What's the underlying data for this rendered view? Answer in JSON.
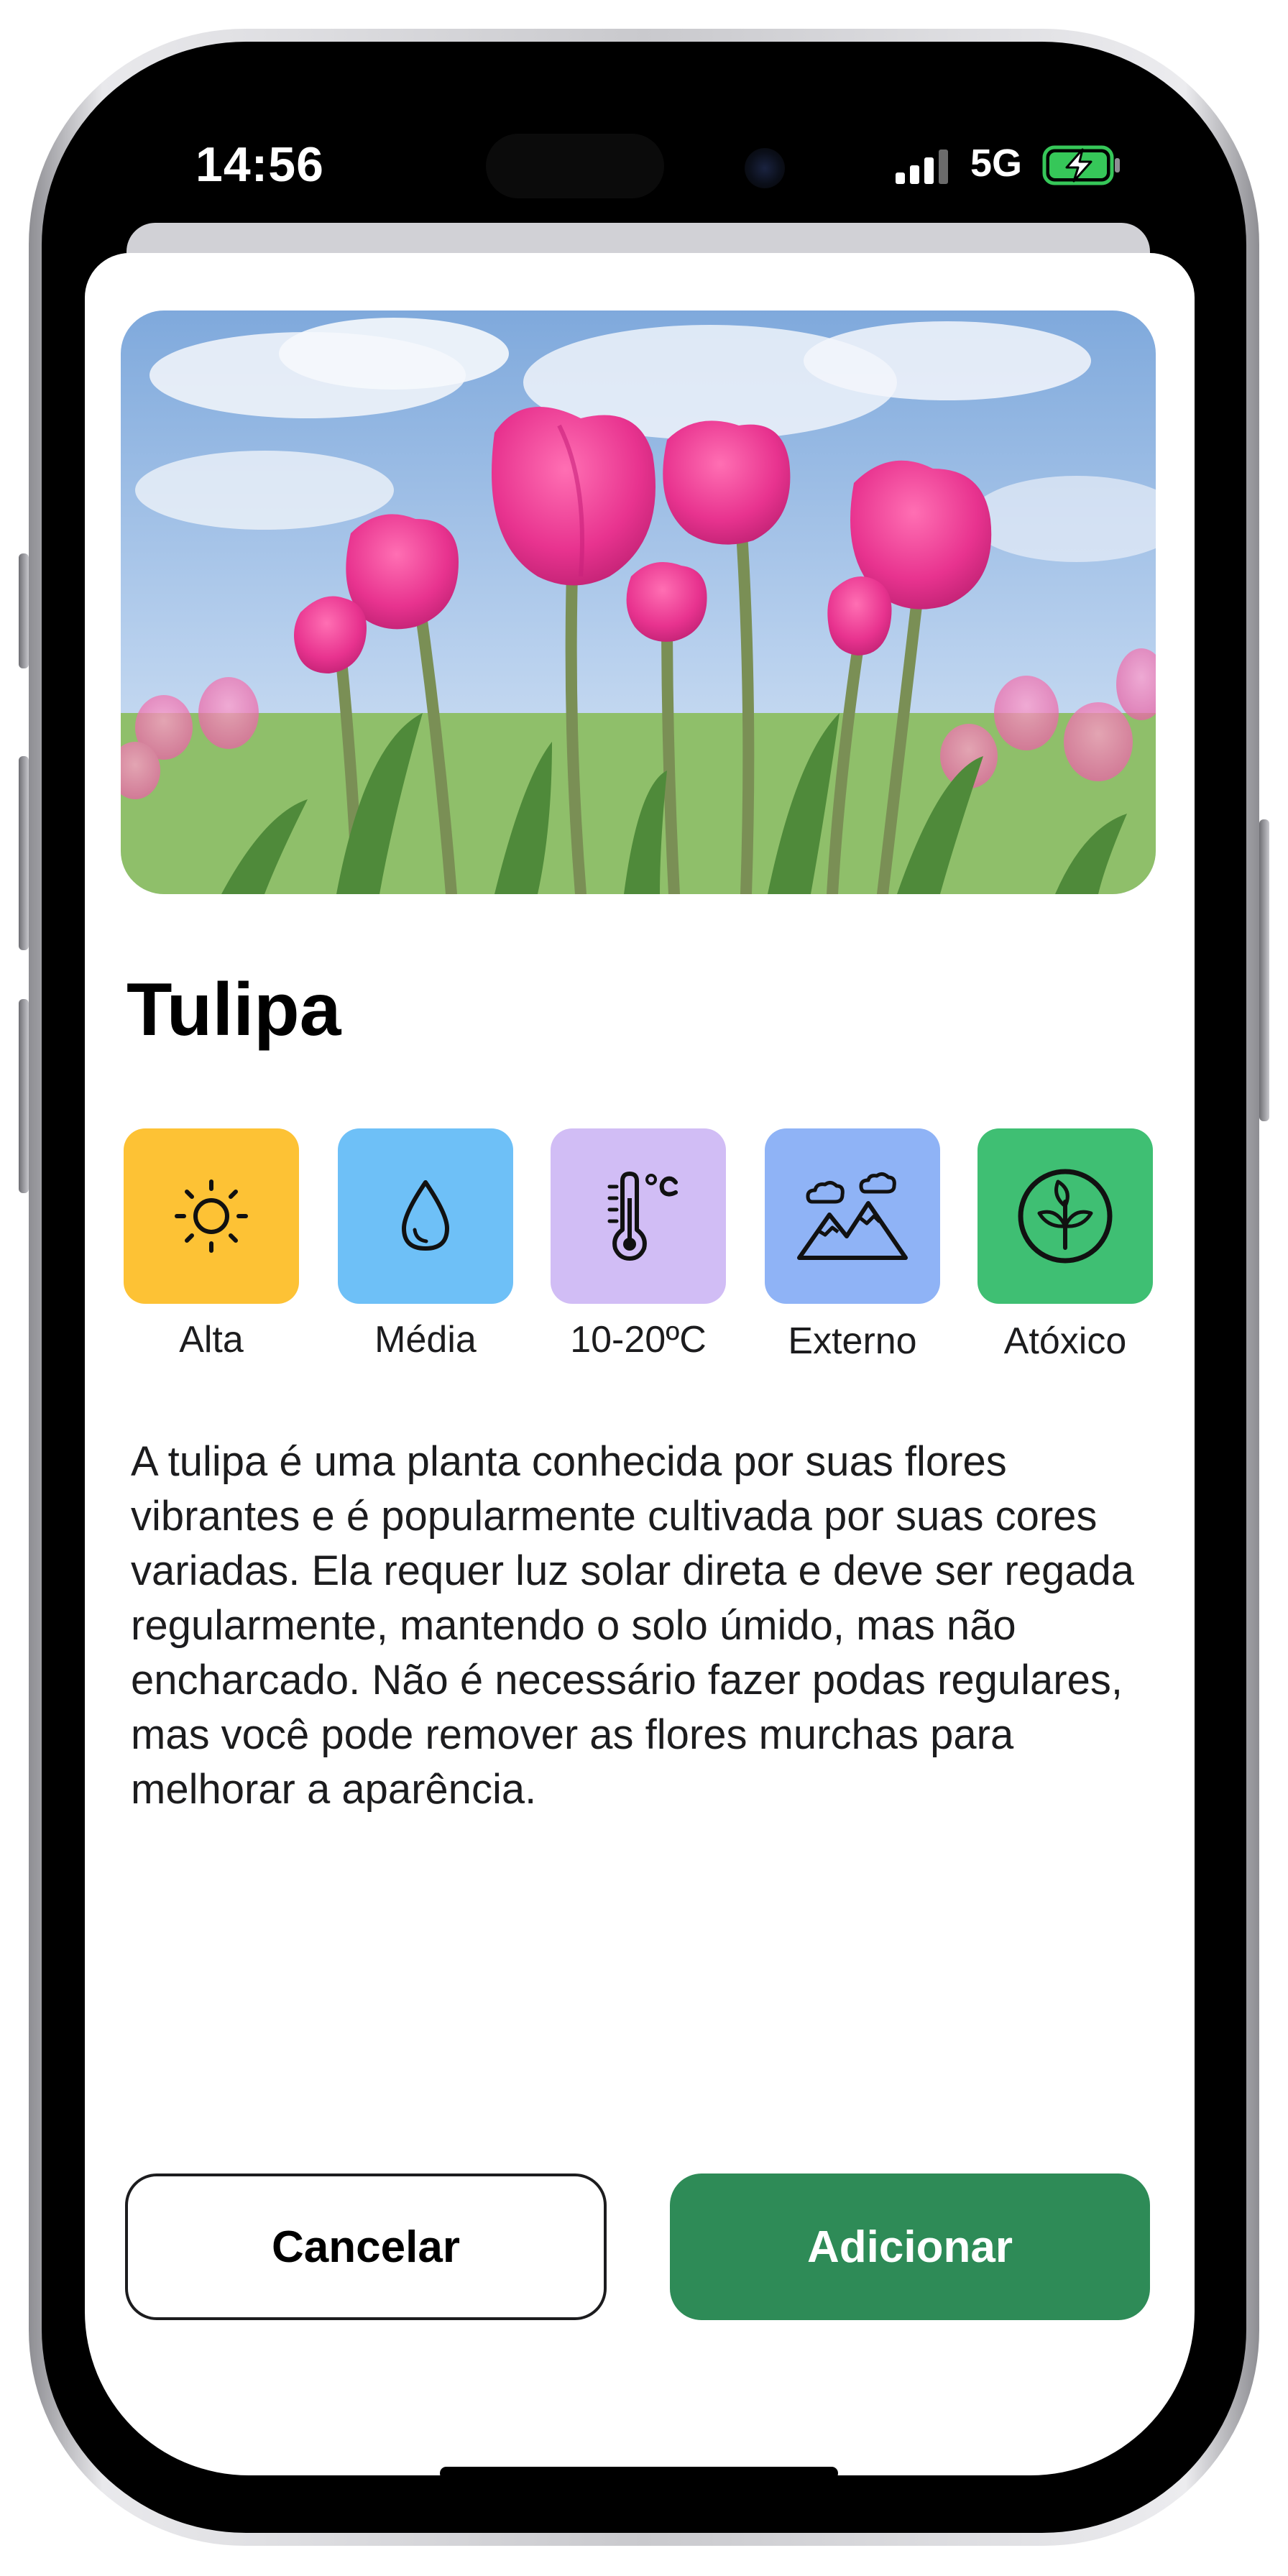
{
  "status_bar": {
    "time": "14:56",
    "network": "5G",
    "battery_charging": true
  },
  "hero_image": {
    "description_icon": "tulip-photo",
    "alt": "Tulipa"
  },
  "plant": {
    "name": "Tulipa"
  },
  "attributes": [
    {
      "label": "Alta",
      "icon": "sun-icon",
      "color": "#fdc235"
    },
    {
      "label": "Média",
      "icon": "water-drop-icon",
      "color": "#6ec0f7"
    },
    {
      "label": "10-20ºC",
      "icon": "thermometer-icon",
      "color": "#d1bdf5"
    },
    {
      "label": "Externo",
      "icon": "mountain-cloud-icon",
      "color": "#8fb3f6"
    },
    {
      "label": "Atóxico",
      "icon": "leaf-icon",
      "color": "#3fbf73"
    }
  ],
  "description": "A tulipa é uma planta conhecida por suas flores vibrantes e é popularmente cultivada por suas cores variadas. Ela requer luz solar direta e deve ser regada regularmente, mantendo o solo úmido, mas não encharcado. Não é necessário fazer podas regulares, mas você pode remover as flores murchas para melhorar a aparência.",
  "actions": {
    "cancel_label": "Cancelar",
    "add_label": "Adicionar",
    "add_color": "#2e8b57"
  }
}
